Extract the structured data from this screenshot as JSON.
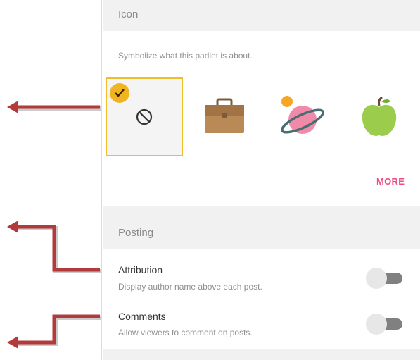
{
  "icon_section": {
    "heading": "Icon",
    "description": "Symbolize what this padlet is about.",
    "icons": [
      {
        "name": "none-icon",
        "selected": true
      },
      {
        "name": "briefcase-icon",
        "selected": false
      },
      {
        "name": "planet-icon",
        "selected": false
      },
      {
        "name": "apple-icon",
        "selected": false
      }
    ],
    "more_label": "MORE"
  },
  "posting_section": {
    "heading": "Posting",
    "attribution": {
      "title": "Attribution",
      "subtitle": "Display author name above each post.",
      "enabled": false
    },
    "comments": {
      "title": "Comments",
      "subtitle": "Allow viewers to comment on posts.",
      "enabled": false
    }
  },
  "colors": {
    "accent_selected": "#f0bd2c",
    "more_link": "#ef4a85",
    "annotation_arrow": "#b23a3a"
  }
}
